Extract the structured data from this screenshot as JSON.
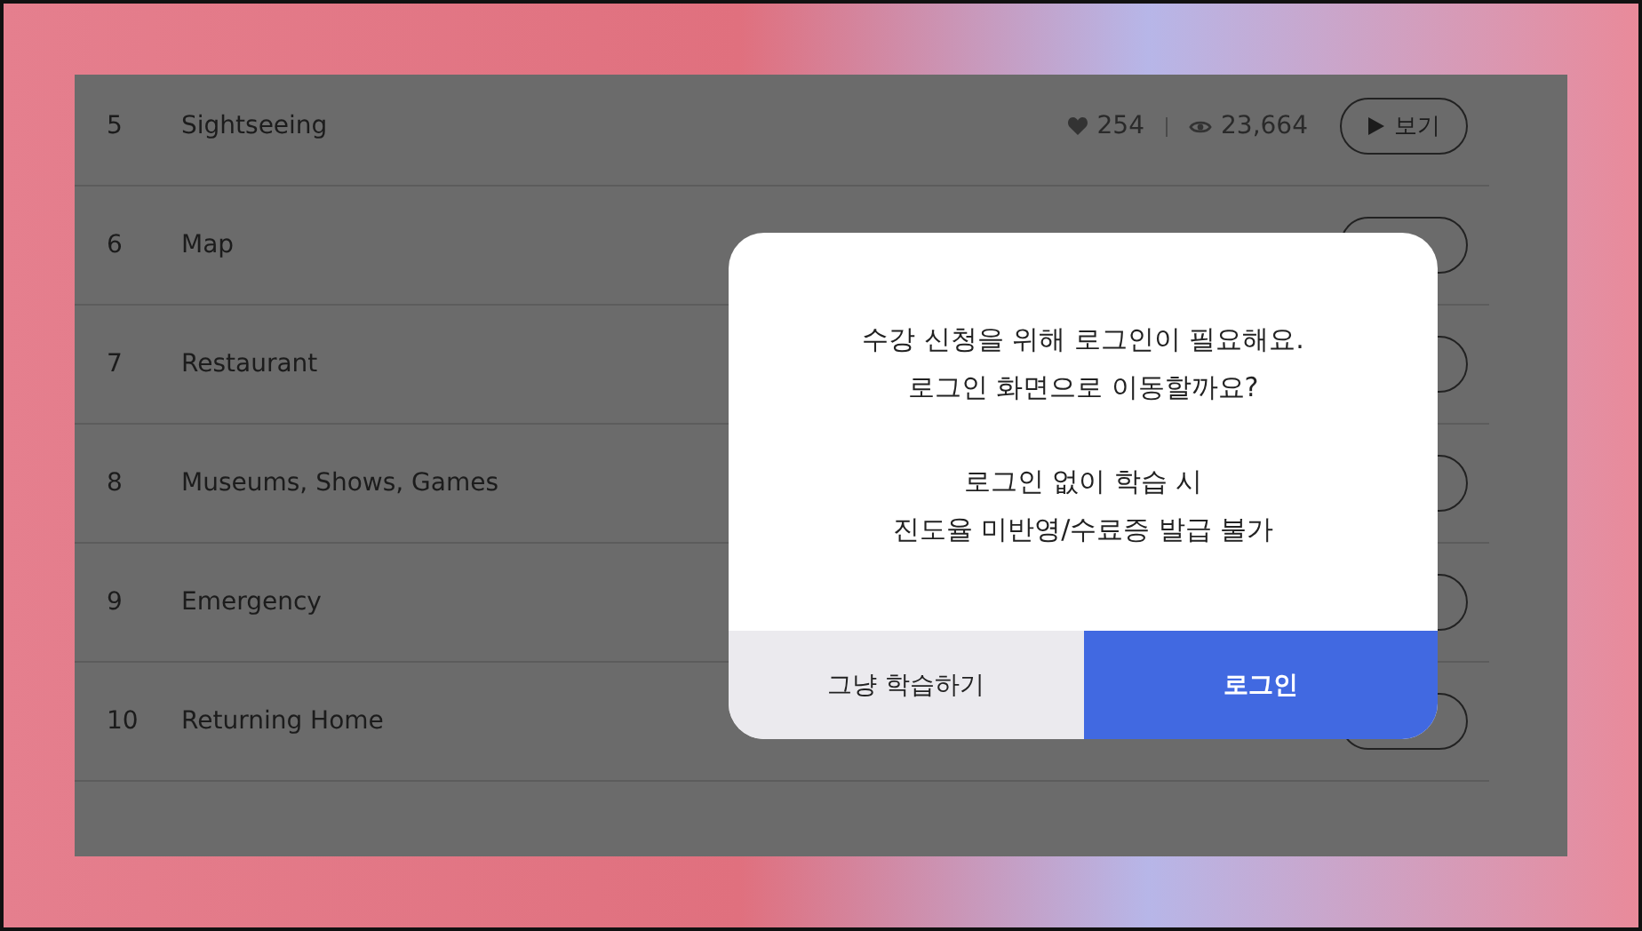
{
  "lessons": [
    {
      "number": "5",
      "title": "Sightseeing",
      "likes": "254",
      "views": "23,664",
      "view_button": "보기"
    },
    {
      "number": "6",
      "title": "Map"
    },
    {
      "number": "7",
      "title": "Restaurant"
    },
    {
      "number": "8",
      "title": "Museums, Shows, Games"
    },
    {
      "number": "9",
      "title": "Emergency"
    },
    {
      "number": "10",
      "title": "Returning Home"
    }
  ],
  "dialog": {
    "message_lines": [
      "수강 신청을 위해 로그인이 필요해요.",
      "로그인 화면으로 이동할까요?"
    ],
    "note_lines": [
      "로그인 없이 학습 시",
      "진도율 미반영/수료증 발급 불가"
    ],
    "cancel_button": "그냥 학습하기",
    "confirm_button": "로그인"
  }
}
